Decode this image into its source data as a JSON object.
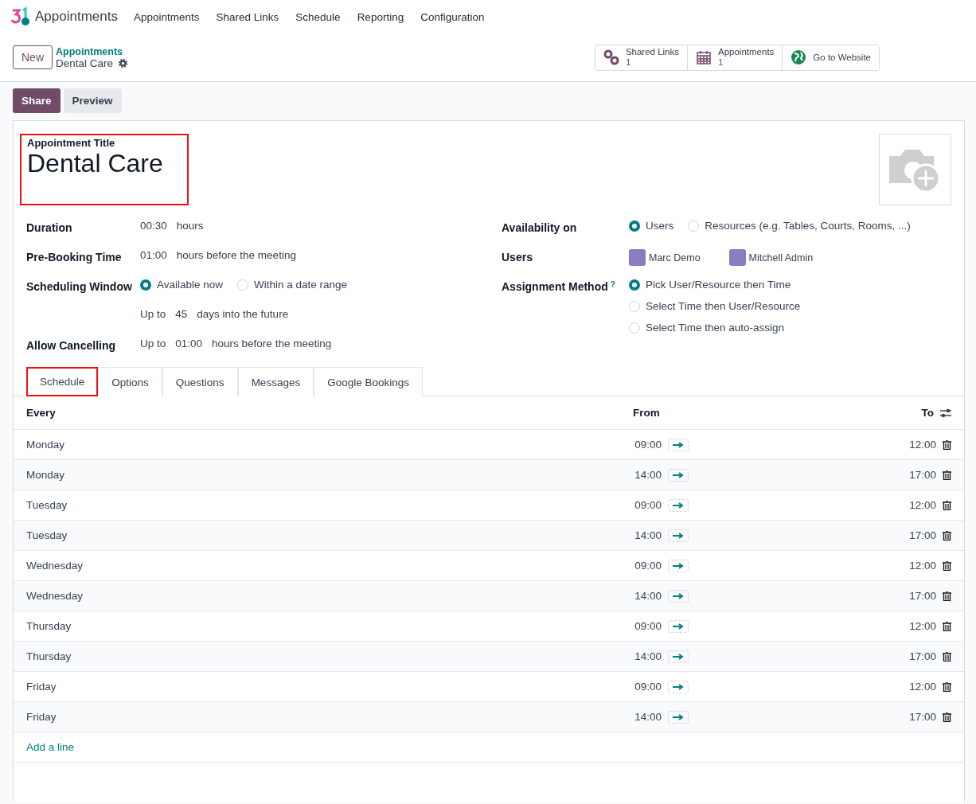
{
  "navbar": {
    "app_name": "Appointments",
    "menu": [
      "Appointments",
      "Shared Links",
      "Schedule",
      "Reporting",
      "Configuration"
    ]
  },
  "control_panel": {
    "new_button": "New",
    "breadcrumb": "Appointments",
    "record_name": "Dental Care",
    "smart_buttons": [
      {
        "kind": "links",
        "label": "Shared Links",
        "count": "1"
      },
      {
        "kind": "calendar",
        "label": "Appointments",
        "count": "1"
      },
      {
        "kind": "globe",
        "label": "Go to Website"
      }
    ]
  },
  "actions": [
    {
      "label": "Share",
      "primary": true
    },
    {
      "label": "Preview",
      "primary": false
    }
  ],
  "form": {
    "title_label": "Appointment Title",
    "title": "Dental Care",
    "title_highlighted": true,
    "left_fields": [
      {
        "kind": "text",
        "label": "Duration",
        "parts": [
          "00:30",
          "hours"
        ]
      },
      {
        "kind": "text",
        "label": "Pre-Booking Time",
        "parts": [
          "01:00",
          "hours before the meeting"
        ]
      },
      {
        "kind": "radio",
        "label": "Scheduling Window",
        "options": [
          {
            "label": "Available now",
            "selected": true
          },
          {
            "label": "Within a date range",
            "selected": false
          }
        ]
      },
      {
        "kind": "text",
        "parts": [
          "Up to",
          "45",
          "days into the future"
        ]
      },
      {
        "kind": "text",
        "label": "Allow Cancelling",
        "parts": [
          "Up to",
          "01:00",
          "hours before the meeting"
        ]
      }
    ],
    "right_fields": [
      {
        "kind": "radio",
        "label": "Availability on",
        "options": [
          {
            "label": "Users",
            "selected": true
          },
          {
            "label": "Resources (e.g. Tables, Courts, Rooms, ...)",
            "selected": false
          }
        ]
      },
      {
        "kind": "users",
        "label": "Users",
        "users": [
          "Marc Demo",
          "Mitchell Admin"
        ]
      },
      {
        "kind": "radio_stack",
        "label": "Assignment Method",
        "help": "?",
        "options": [
          {
            "label": "Pick User/Resource then Time",
            "selected": true
          },
          {
            "label": "Select Time then User/Resource",
            "selected": false
          },
          {
            "label": "Select Time then auto-assign",
            "selected": false
          }
        ]
      }
    ]
  },
  "tabs": [
    {
      "label": "Schedule",
      "selected": true,
      "highlighted": true
    },
    {
      "label": "Options",
      "selected": false,
      "highlighted": false
    },
    {
      "label": "Questions",
      "selected": false,
      "highlighted": false
    },
    {
      "label": "Messages",
      "selected": false,
      "highlighted": false
    },
    {
      "label": "Google Bookings",
      "selected": false,
      "highlighted": false
    }
  ],
  "table": {
    "columns": [
      "Every",
      "From",
      "To"
    ],
    "rows": [
      {
        "day": "Monday",
        "from": "09:00",
        "to": "12:00"
      },
      {
        "day": "Monday",
        "from": "14:00",
        "to": "17:00"
      },
      {
        "day": "Tuesday",
        "from": "09:00",
        "to": "12:00"
      },
      {
        "day": "Tuesday",
        "from": "14:00",
        "to": "17:00"
      },
      {
        "day": "Wednesday",
        "from": "09:00",
        "to": "12:00"
      },
      {
        "day": "Wednesday",
        "from": "14:00",
        "to": "17:00"
      },
      {
        "day": "Thursday",
        "from": "09:00",
        "to": "12:00"
      },
      {
        "day": "Thursday",
        "from": "14:00",
        "to": "17:00"
      },
      {
        "day": "Friday",
        "from": "09:00",
        "to": "12:00"
      },
      {
        "day": "Friday",
        "from": "14:00",
        "to": "17:00"
      }
    ],
    "add_line": "Add a line"
  }
}
